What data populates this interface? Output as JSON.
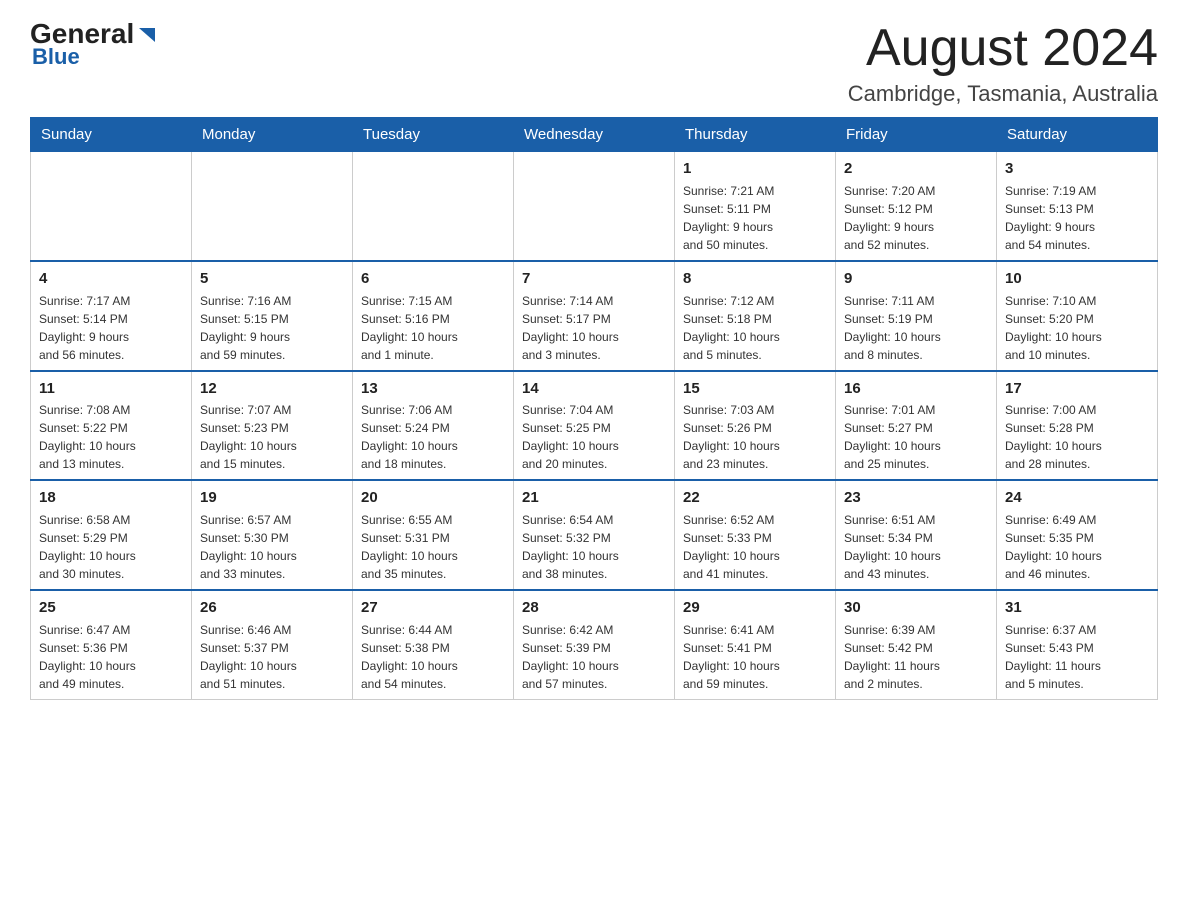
{
  "header": {
    "logo_main": "General",
    "logo_triangle": "▶",
    "logo_blue": "Blue",
    "title": "August 2024",
    "location": "Cambridge, Tasmania, Australia"
  },
  "calendar": {
    "days_of_week": [
      "Sunday",
      "Monday",
      "Tuesday",
      "Wednesday",
      "Thursday",
      "Friday",
      "Saturday"
    ],
    "weeks": [
      [
        {
          "day": "",
          "info": ""
        },
        {
          "day": "",
          "info": ""
        },
        {
          "day": "",
          "info": ""
        },
        {
          "day": "",
          "info": ""
        },
        {
          "day": "1",
          "info": "Sunrise: 7:21 AM\nSunset: 5:11 PM\nDaylight: 9 hours\nand 50 minutes."
        },
        {
          "day": "2",
          "info": "Sunrise: 7:20 AM\nSunset: 5:12 PM\nDaylight: 9 hours\nand 52 minutes."
        },
        {
          "day": "3",
          "info": "Sunrise: 7:19 AM\nSunset: 5:13 PM\nDaylight: 9 hours\nand 54 minutes."
        }
      ],
      [
        {
          "day": "4",
          "info": "Sunrise: 7:17 AM\nSunset: 5:14 PM\nDaylight: 9 hours\nand 56 minutes."
        },
        {
          "day": "5",
          "info": "Sunrise: 7:16 AM\nSunset: 5:15 PM\nDaylight: 9 hours\nand 59 minutes."
        },
        {
          "day": "6",
          "info": "Sunrise: 7:15 AM\nSunset: 5:16 PM\nDaylight: 10 hours\nand 1 minute."
        },
        {
          "day": "7",
          "info": "Sunrise: 7:14 AM\nSunset: 5:17 PM\nDaylight: 10 hours\nand 3 minutes."
        },
        {
          "day": "8",
          "info": "Sunrise: 7:12 AM\nSunset: 5:18 PM\nDaylight: 10 hours\nand 5 minutes."
        },
        {
          "day": "9",
          "info": "Sunrise: 7:11 AM\nSunset: 5:19 PM\nDaylight: 10 hours\nand 8 minutes."
        },
        {
          "day": "10",
          "info": "Sunrise: 7:10 AM\nSunset: 5:20 PM\nDaylight: 10 hours\nand 10 minutes."
        }
      ],
      [
        {
          "day": "11",
          "info": "Sunrise: 7:08 AM\nSunset: 5:22 PM\nDaylight: 10 hours\nand 13 minutes."
        },
        {
          "day": "12",
          "info": "Sunrise: 7:07 AM\nSunset: 5:23 PM\nDaylight: 10 hours\nand 15 minutes."
        },
        {
          "day": "13",
          "info": "Sunrise: 7:06 AM\nSunset: 5:24 PM\nDaylight: 10 hours\nand 18 minutes."
        },
        {
          "day": "14",
          "info": "Sunrise: 7:04 AM\nSunset: 5:25 PM\nDaylight: 10 hours\nand 20 minutes."
        },
        {
          "day": "15",
          "info": "Sunrise: 7:03 AM\nSunset: 5:26 PM\nDaylight: 10 hours\nand 23 minutes."
        },
        {
          "day": "16",
          "info": "Sunrise: 7:01 AM\nSunset: 5:27 PM\nDaylight: 10 hours\nand 25 minutes."
        },
        {
          "day": "17",
          "info": "Sunrise: 7:00 AM\nSunset: 5:28 PM\nDaylight: 10 hours\nand 28 minutes."
        }
      ],
      [
        {
          "day": "18",
          "info": "Sunrise: 6:58 AM\nSunset: 5:29 PM\nDaylight: 10 hours\nand 30 minutes."
        },
        {
          "day": "19",
          "info": "Sunrise: 6:57 AM\nSunset: 5:30 PM\nDaylight: 10 hours\nand 33 minutes."
        },
        {
          "day": "20",
          "info": "Sunrise: 6:55 AM\nSunset: 5:31 PM\nDaylight: 10 hours\nand 35 minutes."
        },
        {
          "day": "21",
          "info": "Sunrise: 6:54 AM\nSunset: 5:32 PM\nDaylight: 10 hours\nand 38 minutes."
        },
        {
          "day": "22",
          "info": "Sunrise: 6:52 AM\nSunset: 5:33 PM\nDaylight: 10 hours\nand 41 minutes."
        },
        {
          "day": "23",
          "info": "Sunrise: 6:51 AM\nSunset: 5:34 PM\nDaylight: 10 hours\nand 43 minutes."
        },
        {
          "day": "24",
          "info": "Sunrise: 6:49 AM\nSunset: 5:35 PM\nDaylight: 10 hours\nand 46 minutes."
        }
      ],
      [
        {
          "day": "25",
          "info": "Sunrise: 6:47 AM\nSunset: 5:36 PM\nDaylight: 10 hours\nand 49 minutes."
        },
        {
          "day": "26",
          "info": "Sunrise: 6:46 AM\nSunset: 5:37 PM\nDaylight: 10 hours\nand 51 minutes."
        },
        {
          "day": "27",
          "info": "Sunrise: 6:44 AM\nSunset: 5:38 PM\nDaylight: 10 hours\nand 54 minutes."
        },
        {
          "day": "28",
          "info": "Sunrise: 6:42 AM\nSunset: 5:39 PM\nDaylight: 10 hours\nand 57 minutes."
        },
        {
          "day": "29",
          "info": "Sunrise: 6:41 AM\nSunset: 5:41 PM\nDaylight: 10 hours\nand 59 minutes."
        },
        {
          "day": "30",
          "info": "Sunrise: 6:39 AM\nSunset: 5:42 PM\nDaylight: 11 hours\nand 2 minutes."
        },
        {
          "day": "31",
          "info": "Sunrise: 6:37 AM\nSunset: 5:43 PM\nDaylight: 11 hours\nand 5 minutes."
        }
      ]
    ]
  }
}
